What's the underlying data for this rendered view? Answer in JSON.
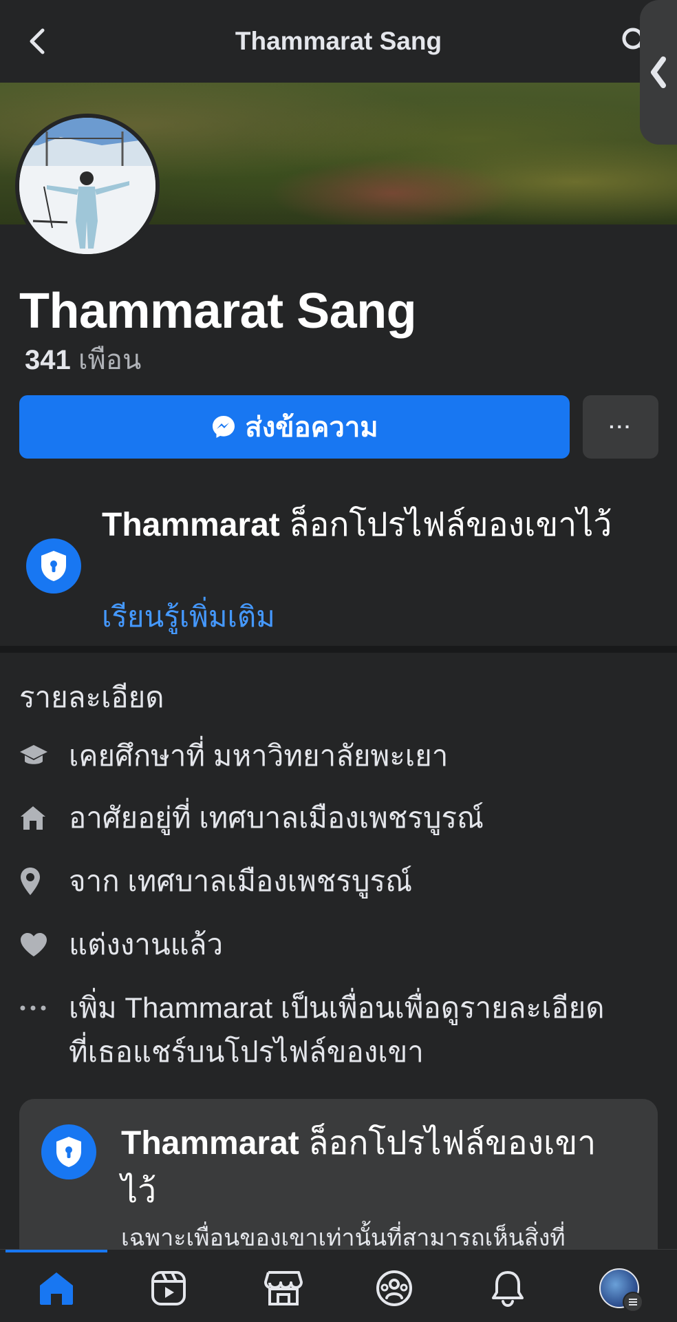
{
  "header": {
    "title": "Thammarat Sang"
  },
  "profile": {
    "name": "Thammarat Sang",
    "friends_count": "341",
    "friends_label": "เพือน",
    "message_button": "ส่งข้อความ",
    "more_button": "···"
  },
  "lock_notice": {
    "name": "Thammarat",
    "text": "ล็อกโปรไฟล์ของเขาไว้",
    "learn_more": "เรียนรู้เพิ่มเติม"
  },
  "details": {
    "heading": "รายละเอียด",
    "items": [
      {
        "icon": "education-cap-icon",
        "text": "เคยศึกษาที่ มหาวิทยาลัยพะเยา"
      },
      {
        "icon": "home-icon",
        "text": "อาศัยอยู่ที่ เทศบาลเมืองเพชรบูรณ์"
      },
      {
        "icon": "location-pin-icon",
        "text": "จาก เทศบาลเมืองเพชรบูรณ์"
      },
      {
        "icon": "heart-icon",
        "text": "แต่งงานแล้ว"
      },
      {
        "icon": "more-dots-icon",
        "text": "เพิ่ม Thammarat เป็นเพื่อนเพื่อดูรายละเอียดที่เธอแชร์บนโปรไฟล์ของเขา"
      }
    ]
  },
  "lock_card": {
    "name": "Thammarat",
    "text": "ล็อกโปรไฟล์ของเขาไว้",
    "subtext": "เฉพาะเพื่อนของเขาเท่านั้นที่สามารถเห็นสิ่งที่"
  },
  "tabbar": {
    "tabs": [
      "home-icon",
      "video-icon",
      "marketplace-icon",
      "groups-icon",
      "notifications-icon",
      "profile-menu-avatar"
    ]
  },
  "colors": {
    "accent": "#1877f2",
    "link": "#4599ff",
    "background": "#242526",
    "card": "#3a3b3c"
  }
}
